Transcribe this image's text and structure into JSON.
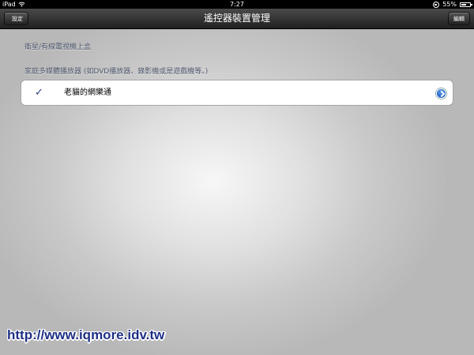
{
  "status_bar": {
    "device": "iPad",
    "time": "7:27",
    "battery": "55%",
    "battery_level_percent": 55
  },
  "nav": {
    "back_label": "設定",
    "title": "遙控器裝置管理",
    "edit_label": "編輯"
  },
  "sections": {
    "tv_box_header": "衛星/有線電視機上盒",
    "media_player_header": "家庭多媒體播放器 (如DVD播放器、錄影機或是遊戲機等。)"
  },
  "device_cell": {
    "checkmark": "✓",
    "label": "老貓的網樂通"
  },
  "watermark": "http://www.iqmore.idv.tw",
  "colors": {
    "nav_bar": "#2b2b2b",
    "section_header_text": "#4c566a",
    "check_color": "#2a3e7a",
    "disclosure_blue": "#2a6ad0",
    "watermark_text": "#1f2f86"
  }
}
